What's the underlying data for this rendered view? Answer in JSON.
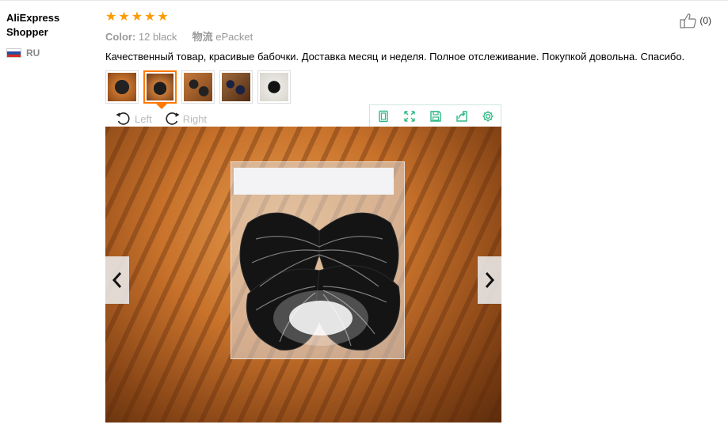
{
  "review": {
    "user_name": "AliExpress Shopper",
    "country_code": "RU",
    "rating": 5,
    "color_label": "Color:",
    "color_value": "12 black",
    "shipping_label": "物流",
    "shipping_value": "ePacket",
    "text": "Качественный товар, красивые бабочки. Доставка месяц и неделя. Полное отслеживание. Покупкой довольна. Спасибо.",
    "helpful_count": "(0)"
  },
  "viewer": {
    "rotate_left_label": "Left",
    "rotate_right_label": "Right",
    "active_thumb_index": 1
  },
  "icons": {
    "stars": "star-icon",
    "like": "thumbs-up-icon",
    "flag": "russia-flag-icon",
    "rotate_left": "rotate-left-icon",
    "rotate_right": "rotate-right-icon",
    "toolbar": [
      "portrait-icon",
      "fullscreen-icon",
      "save-icon",
      "share-icon",
      "settings-icon"
    ],
    "prev": "chevron-left-icon",
    "next": "chevron-right-icon"
  },
  "colors": {
    "star": "#ff9a00",
    "active_thumb": "#ff7a00",
    "toolbar_icon": "#2fb886"
  }
}
